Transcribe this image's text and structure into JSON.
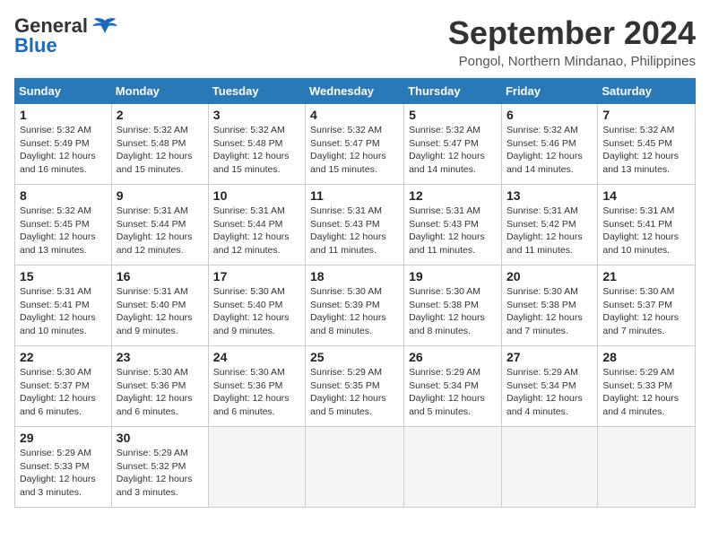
{
  "logo": {
    "line1": "General",
    "line2": "Blue"
  },
  "title": "September 2024",
  "location": "Pongol, Northern Mindanao, Philippines",
  "headers": [
    "Sunday",
    "Monday",
    "Tuesday",
    "Wednesday",
    "Thursday",
    "Friday",
    "Saturday"
  ],
  "weeks": [
    [
      {
        "day": "1",
        "rise": "5:32 AM",
        "set": "5:49 PM",
        "daylight": "12 hours and 16 minutes."
      },
      {
        "day": "2",
        "rise": "5:32 AM",
        "set": "5:48 PM",
        "daylight": "12 hours and 15 minutes."
      },
      {
        "day": "3",
        "rise": "5:32 AM",
        "set": "5:48 PM",
        "daylight": "12 hours and 15 minutes."
      },
      {
        "day": "4",
        "rise": "5:32 AM",
        "set": "5:47 PM",
        "daylight": "12 hours and 15 minutes."
      },
      {
        "day": "5",
        "rise": "5:32 AM",
        "set": "5:47 PM",
        "daylight": "12 hours and 14 minutes."
      },
      {
        "day": "6",
        "rise": "5:32 AM",
        "set": "5:46 PM",
        "daylight": "12 hours and 14 minutes."
      },
      {
        "day": "7",
        "rise": "5:32 AM",
        "set": "5:45 PM",
        "daylight": "12 hours and 13 minutes."
      }
    ],
    [
      {
        "day": "8",
        "rise": "5:32 AM",
        "set": "5:45 PM",
        "daylight": "12 hours and 13 minutes."
      },
      {
        "day": "9",
        "rise": "5:31 AM",
        "set": "5:44 PM",
        "daylight": "12 hours and 12 minutes."
      },
      {
        "day": "10",
        "rise": "5:31 AM",
        "set": "5:44 PM",
        "daylight": "12 hours and 12 minutes."
      },
      {
        "day": "11",
        "rise": "5:31 AM",
        "set": "5:43 PM",
        "daylight": "12 hours and 11 minutes."
      },
      {
        "day": "12",
        "rise": "5:31 AM",
        "set": "5:43 PM",
        "daylight": "12 hours and 11 minutes."
      },
      {
        "day": "13",
        "rise": "5:31 AM",
        "set": "5:42 PM",
        "daylight": "12 hours and 11 minutes."
      },
      {
        "day": "14",
        "rise": "5:31 AM",
        "set": "5:41 PM",
        "daylight": "12 hours and 10 minutes."
      }
    ],
    [
      {
        "day": "15",
        "rise": "5:31 AM",
        "set": "5:41 PM",
        "daylight": "12 hours and 10 minutes."
      },
      {
        "day": "16",
        "rise": "5:31 AM",
        "set": "5:40 PM",
        "daylight": "12 hours and 9 minutes."
      },
      {
        "day": "17",
        "rise": "5:30 AM",
        "set": "5:40 PM",
        "daylight": "12 hours and 9 minutes."
      },
      {
        "day": "18",
        "rise": "5:30 AM",
        "set": "5:39 PM",
        "daylight": "12 hours and 8 minutes."
      },
      {
        "day": "19",
        "rise": "5:30 AM",
        "set": "5:38 PM",
        "daylight": "12 hours and 8 minutes."
      },
      {
        "day": "20",
        "rise": "5:30 AM",
        "set": "5:38 PM",
        "daylight": "12 hours and 7 minutes."
      },
      {
        "day": "21",
        "rise": "5:30 AM",
        "set": "5:37 PM",
        "daylight": "12 hours and 7 minutes."
      }
    ],
    [
      {
        "day": "22",
        "rise": "5:30 AM",
        "set": "5:37 PM",
        "daylight": "12 hours and 6 minutes."
      },
      {
        "day": "23",
        "rise": "5:30 AM",
        "set": "5:36 PM",
        "daylight": "12 hours and 6 minutes."
      },
      {
        "day": "24",
        "rise": "5:30 AM",
        "set": "5:36 PM",
        "daylight": "12 hours and 6 minutes."
      },
      {
        "day": "25",
        "rise": "5:29 AM",
        "set": "5:35 PM",
        "daylight": "12 hours and 5 minutes."
      },
      {
        "day": "26",
        "rise": "5:29 AM",
        "set": "5:34 PM",
        "daylight": "12 hours and 5 minutes."
      },
      {
        "day": "27",
        "rise": "5:29 AM",
        "set": "5:34 PM",
        "daylight": "12 hours and 4 minutes."
      },
      {
        "day": "28",
        "rise": "5:29 AM",
        "set": "5:33 PM",
        "daylight": "12 hours and 4 minutes."
      }
    ],
    [
      {
        "day": "29",
        "rise": "5:29 AM",
        "set": "5:33 PM",
        "daylight": "12 hours and 3 minutes."
      },
      {
        "day": "30",
        "rise": "5:29 AM",
        "set": "5:32 PM",
        "daylight": "12 hours and 3 minutes."
      },
      null,
      null,
      null,
      null,
      null
    ]
  ]
}
